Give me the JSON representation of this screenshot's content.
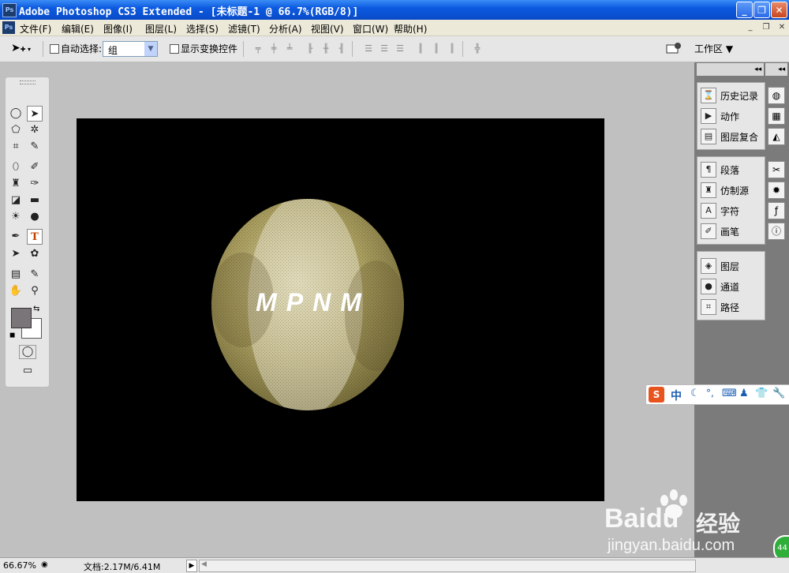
{
  "window": {
    "title": "Adobe Photoshop CS3 Extended - [未标题-1 @ 66.7%(RGB/8)]",
    "app_icon": "Ps",
    "buttons": {
      "minimize": "_",
      "restore": "❐",
      "close": "✕"
    }
  },
  "menu": {
    "items": [
      "文件(F)",
      "编辑(E)",
      "图像(I)",
      "图层(L)",
      "选择(S)",
      "滤镜(T)",
      "分析(A)",
      "视图(V)",
      "窗口(W)",
      "帮助(H)"
    ],
    "mdi_buttons": [
      "_",
      "❐",
      "✕"
    ]
  },
  "options_bar": {
    "auto_select_label": "自动选择:",
    "auto_select_value": "组",
    "show_transform_label": "显示变换控件",
    "workspace_label": "工作区"
  },
  "canvas": {
    "text": "MPNM",
    "background": "#000000",
    "sphere_color": "#a89c5e"
  },
  "panels": {
    "group1": [
      "历史记录",
      "动作",
      "图层复合"
    ],
    "group2": [
      "段落",
      "仿制源",
      "字符",
      "画笔"
    ],
    "group3": [
      "图层",
      "通道",
      "路径"
    ]
  },
  "ime": {
    "label": "中"
  },
  "status": {
    "zoom": "66.67%",
    "doc": "文档:2.17M/6.41M"
  },
  "watermark": {
    "brand": "Baidu",
    "brand_cn": "经验",
    "url": "jingyan.baidu.com"
  }
}
